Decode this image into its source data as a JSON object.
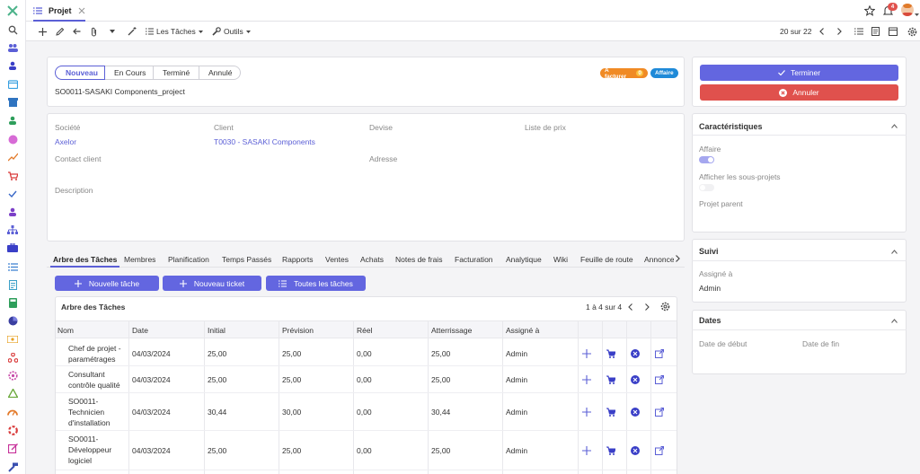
{
  "app": {
    "tab_label": "Projet",
    "pagination": "20 sur 22"
  },
  "toolbar": {
    "tasks_menu": "Les Tâches",
    "tools_menu": "Outils"
  },
  "notifications": {
    "count": "4"
  },
  "status_steps": [
    "Nouveau",
    "En Cours",
    "Terminé",
    "Annulé"
  ],
  "status_active": "Nouveau",
  "badges": {
    "to_invoice": "A facturer",
    "to_invoice_count": "0",
    "business": "Affaire"
  },
  "project_name": "SO0011-SASAKI Components_project",
  "fields": {
    "company_label": "Société",
    "company_value": "Axelor",
    "client_label": "Client",
    "client_value": "T0030 - SASAKI Components",
    "currency_label": "Devise",
    "pricelist_label": "Liste de prix",
    "contact_label": "Contact client",
    "address_label": "Adresse",
    "description_label": "Description"
  },
  "actions": {
    "finish": "Terminer",
    "cancel": "Annuler"
  },
  "tabs": [
    "Arbre des Tâches",
    "Membres",
    "Planification",
    "Temps Passés",
    "Rapports",
    "Ventes",
    "Achats",
    "Notes de frais",
    "Facturation",
    "Analytique",
    "Wiki",
    "Feuille de route",
    "Annonce"
  ],
  "task_buttons": {
    "new_task": "Nouvelle tâche",
    "new_ticket": "Nouveau ticket",
    "all_tasks": "Toutes les tâches"
  },
  "task_tree": {
    "title": "Arbre des Tâches",
    "pagination": "1 à 4 sur 4",
    "columns": [
      "Nom",
      "Date",
      "Initial",
      "Prévision",
      "Réel",
      "Atterrissage",
      "Assigné à"
    ],
    "rows": [
      {
        "name_l1": "Chef de projet -",
        "name_l2": "paramétrages",
        "name_l3": "",
        "date": "04/03/2024",
        "initial": "25,00",
        "forecast": "25,00",
        "real": "0,00",
        "landing": "25,00",
        "assigned": "Admin"
      },
      {
        "name_l1": "Consultant",
        "name_l2": "contrôle qualité",
        "name_l3": "",
        "date": "04/03/2024",
        "initial": "25,00",
        "forecast": "25,00",
        "real": "0,00",
        "landing": "25,00",
        "assigned": "Admin"
      },
      {
        "name_l1": "SO0011-",
        "name_l2": "Technicien",
        "name_l3": "d'installation",
        "date": "04/03/2024",
        "initial": "30,44",
        "forecast": "30,00",
        "real": "0,00",
        "landing": "30,44",
        "assigned": "Admin"
      },
      {
        "name_l1": "SO0011-",
        "name_l2": "Développeur",
        "name_l3": "logiciel",
        "date": "04/03/2024",
        "initial": "25,00",
        "forecast": "25,00",
        "real": "0,00",
        "landing": "25,00",
        "assigned": "Admin"
      }
    ]
  },
  "characteristics": {
    "title": "Caractéristiques",
    "business_label": "Affaire",
    "business_on": true,
    "subprojects_label": "Afficher les sous-projets",
    "subprojects_on": false,
    "parent_label": "Projet parent"
  },
  "followup": {
    "title": "Suivi",
    "assigned_label": "Assigné à",
    "assigned_value": "Admin"
  },
  "dates": {
    "title": "Dates",
    "start_label": "Date de début",
    "end_label": "Date de fin"
  },
  "colors": {
    "accent": "#5b5fd6",
    "finish_btn": "#6366e0",
    "cancel_btn": "#e0514d",
    "badge_orange": "#f08a24",
    "badge_blue": "#1f8ad8"
  }
}
